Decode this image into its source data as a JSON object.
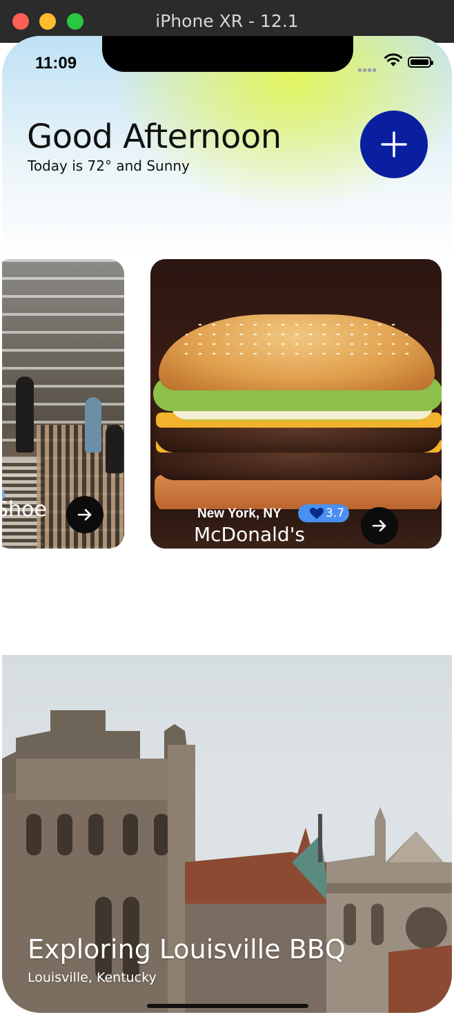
{
  "window": {
    "title": "iPhone XR - 12.1"
  },
  "status_bar": {
    "time": "11:09"
  },
  "header": {
    "greeting": "Good Afternoon",
    "subtitle": "Today is 72° and Sunny",
    "add_button_icon": "plus-icon"
  },
  "cards": [
    {
      "title": "Shoe",
      "arrow_icon": "arrow-right-icon"
    },
    {
      "location": "New York,  NY",
      "rating": "3.7",
      "rating_icon": "heart-icon",
      "title": "McDonald's",
      "arrow_icon": "arrow-right-icon"
    }
  ],
  "featured": {
    "title": "Exploring Louisville BBQ",
    "subtitle": "Louisville, Kentucky"
  },
  "colors": {
    "add_button": "#0a1fa0",
    "rating_badge": "#4a90f0",
    "gradient_yellow": "#e2f55e",
    "gradient_blue": "#bfe1f4"
  }
}
